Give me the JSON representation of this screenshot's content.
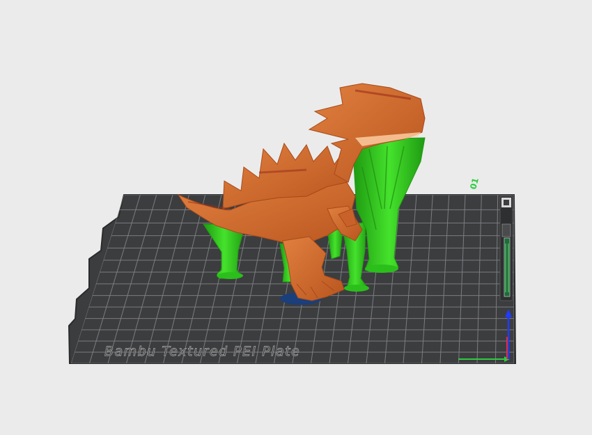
{
  "scene": {
    "plate_label": "Bambu Textured PEI Plate",
    "plate_number": "01",
    "colors": {
      "background": "#ebebeb",
      "plate": "#3c3d3f",
      "grid": "#7c7d80",
      "model": "#d46c2e",
      "model_shadow": "#b0521f",
      "support": "#33d11f",
      "support_dark": "#1f9a12",
      "contact_patch": "#1a3f7a",
      "axis_x": "#2ecc40",
      "axis_y": "#ff2a2a",
      "axis_z": "#1f3bff"
    }
  }
}
